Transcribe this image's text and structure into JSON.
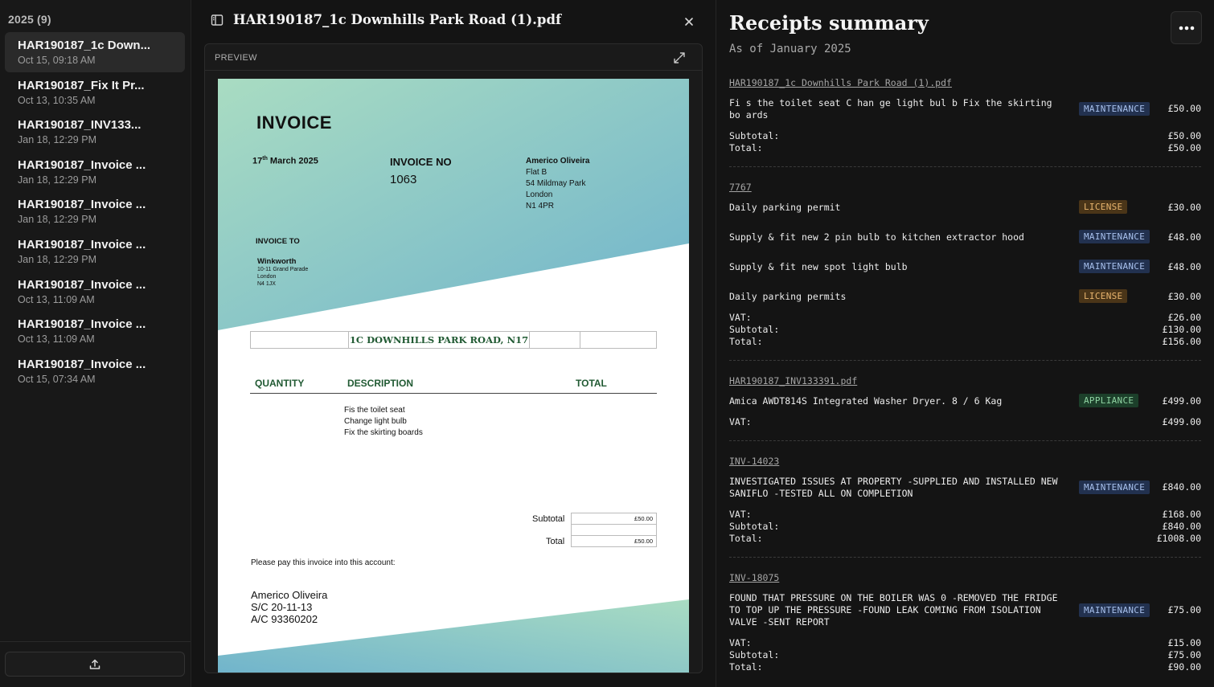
{
  "sidebar": {
    "heading": "2025 (9)",
    "files": [
      {
        "name": "HAR190187_1c Down...",
        "date": "Oct 15, 09:18 AM"
      },
      {
        "name": "HAR190187_Fix It Pr...",
        "date": "Oct 13, 10:35 AM"
      },
      {
        "name": "HAR190187_INV133...",
        "date": "Jan 18, 12:29 PM"
      },
      {
        "name": "HAR190187_Invoice ...",
        "date": "Jan 18, 12:29 PM"
      },
      {
        "name": "HAR190187_Invoice ...",
        "date": "Jan 18, 12:29 PM"
      },
      {
        "name": "HAR190187_Invoice ...",
        "date": "Jan 18, 12:29 PM"
      },
      {
        "name": "HAR190187_Invoice ...",
        "date": "Oct 13, 11:09 AM"
      },
      {
        "name": "HAR190187_Invoice ...",
        "date": "Oct 13, 11:09 AM"
      },
      {
        "name": "HAR190187_Invoice ...",
        "date": "Oct 15, 07:34 AM"
      }
    ],
    "upload_icon": "upload-icon"
  },
  "preview": {
    "title": "HAR190187_1c Downhills Park Road (1).pdf",
    "label": "PREVIEW",
    "icons": {
      "toggle": "sidebar-toggle-icon",
      "close": "close-icon",
      "expand": "expand-icon"
    }
  },
  "invoice": {
    "heading": "INVOICE",
    "date_day": "17",
    "date_suffix": "th",
    "date_rest": " March  2025",
    "number_label": "INVOICE NO",
    "number": "1063",
    "from": [
      "Americo Oliveira",
      "Flat B",
      "54 Mildmay Park",
      "London",
      "N1 4PR"
    ],
    "to_label": "INVOICE TO",
    "to": [
      "Winkworth",
      "10-11 Grand Parade",
      "London",
      "N4 1JX"
    ],
    "address": "1C DOWNHILLS PARK ROAD, N17",
    "col_quantity": "QUANTITY",
    "col_description": "DESCRIPTION",
    "col_total": "TOTAL",
    "items": [
      "Fis the toilet seat",
      "Change light bulb",
      "Fix the skirting boards"
    ],
    "subtotal_label": "Subtotal",
    "subtotal": "£50.00",
    "total_label": "Total",
    "total": "£50.00",
    "pay_note": "Please pay this invoice into this account:",
    "bank": [
      "Americo Oliveira",
      "S/C 20-11-13",
      "A/C 93360202"
    ],
    "colors": {
      "accent_green": "#215a33",
      "gradient_mint": "#a9dcc2",
      "gradient_teal": "#6fb3cc"
    }
  },
  "summary": {
    "title": "Receipts summary",
    "subtitle": "As of January 2025",
    "more_icon": "more-horizontal-icon",
    "receipts": [
      {
        "link": "HAR190187_1c Downhills Park Road (1).pdf",
        "items": [
          {
            "desc": "Fi s the toilet seat C han ge light bul b Fix the skirting bo ards",
            "badge": "MAINTENANCE",
            "amount": "£50.00"
          }
        ],
        "totals": [
          {
            "label": "Subtotal:",
            "value": "£50.00"
          },
          {
            "label": "Total:",
            "value": "£50.00"
          }
        ]
      },
      {
        "link": "7767",
        "items": [
          {
            "desc": "Daily parking permit",
            "badge": "LICENSE",
            "amount": "£30.00"
          },
          {
            "desc": "Supply & fit new 2 pin bulb to kitchen extractor hood",
            "badge": "MAINTENANCE",
            "amount": "£48.00"
          },
          {
            "desc": "Supply & fit new spot light bulb",
            "badge": "MAINTENANCE",
            "amount": "£48.00"
          },
          {
            "desc": "Daily parking permits",
            "badge": "LICENSE",
            "amount": "£30.00"
          }
        ],
        "totals": [
          {
            "label": "VAT:",
            "value": "£26.00"
          },
          {
            "label": "Subtotal:",
            "value": "£130.00"
          },
          {
            "label": "Total:",
            "value": "£156.00"
          }
        ]
      },
      {
        "link": "HAR190187_INV133391.pdf",
        "items": [
          {
            "desc": "Amica AWDT814S Integrated Washer Dryer. 8 / 6 Kag",
            "badge": "APPLIANCE",
            "amount": "£499.00"
          }
        ],
        "totals": [
          {
            "label": "VAT:",
            "value": "£499.00"
          }
        ]
      },
      {
        "link": "INV-14023",
        "items": [
          {
            "desc": "INVESTIGATED ISSUES AT PROPERTY -SUPPLIED AND INSTALLED NEW SANIFLO -TESTED ALL ON COMPLETION",
            "badge": "MAINTENANCE",
            "amount": "£840.00"
          }
        ],
        "totals": [
          {
            "label": "VAT:",
            "value": "£168.00"
          },
          {
            "label": "Subtotal:",
            "value": "£840.00"
          },
          {
            "label": "Total:",
            "value": "£1008.00"
          }
        ]
      },
      {
        "link": "INV-18075",
        "items": [
          {
            "desc": "FOUND THAT PRESSURE ON THE BOILER WAS 0 -REMOVED THE FRIDGE TO TOP UP THE PRESSURE -FOUND LEAK COMING FROM ISOLATION VALVE -SENT REPORT",
            "badge": "MAINTENANCE",
            "amount": "£75.00"
          }
        ],
        "totals": [
          {
            "label": "VAT:",
            "value": "£15.00"
          },
          {
            "label": "Subtotal:",
            "value": "£75.00"
          },
          {
            "label": "Total:",
            "value": "£90.00"
          }
        ]
      }
    ],
    "colors": {
      "maintenance": "#22314f",
      "license": "#4a3518",
      "appliance": "#1c3f2a"
    }
  }
}
